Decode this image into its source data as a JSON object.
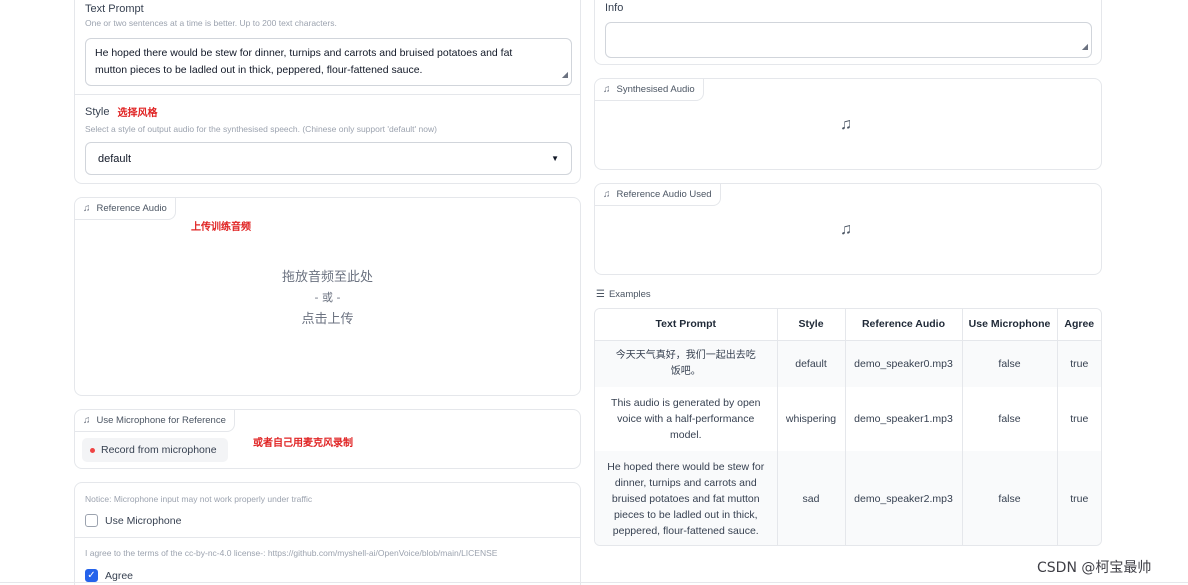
{
  "left": {
    "text_prompt": {
      "title": "Text Prompt",
      "description": "One or two sentences at a time is better. Up to 200 text characters.",
      "value_line1": "He hoped there would be stew for dinner, turnips and carrots and bruised potatoes and fat",
      "value_line2": "mutton pieces to be ladled out in thick, peppered, flour-fattened sauce."
    },
    "style": {
      "title": "Style",
      "annotation": "选择风格",
      "description": "Select a style of output audio for the synthesised speech. (Chinese only support 'default' now)",
      "selected": "default"
    },
    "reference_audio": {
      "label": "Reference Audio",
      "annotation": "上传训练音频",
      "drop_text": "拖放音频至此处",
      "or_text": "- 或 -",
      "click_text": "点击上传"
    },
    "microphone_ref": {
      "label": "Use Microphone for Reference",
      "annotation": "或者自己用麦克风录制",
      "record_button": "Record from microphone"
    },
    "mic_notice": {
      "notice": "Notice: Microphone input may not work properly under traffic",
      "checkbox_label": "Use Microphone",
      "checked": false
    },
    "agree": {
      "terms": "I agree to the terms of the cc-by-nc-4.0 license-: https://github.com/myshell-ai/OpenVoice/blob/main/LICENSE",
      "checkbox_label": "Agree",
      "checked": true
    }
  },
  "right": {
    "info": {
      "title": "Info",
      "value": ""
    },
    "synth_audio": {
      "label": "Synthesised Audio"
    },
    "ref_audio_used": {
      "label": "Reference Audio Used"
    },
    "examples": {
      "label": "Examples",
      "headers": [
        "Text Prompt",
        "Style",
        "Reference Audio",
        "Use Microphone",
        "Agree"
      ],
      "rows": [
        {
          "prompt_lines": [
            "今天天气真好，我们一起出去吃",
            "饭吧。"
          ],
          "style": "default",
          "audio": "demo_speaker0.mp3",
          "mic": "false",
          "agree": "true"
        },
        {
          "prompt_lines": [
            "This audio is generated by open",
            "voice with a half-performance",
            "model."
          ],
          "style": "whispering",
          "audio": "demo_speaker1.mp3",
          "mic": "false",
          "agree": "true"
        },
        {
          "prompt_lines": [
            "He hoped there would be stew for",
            "dinner, turnips and carrots and",
            "bruised potatoes and fat mutton",
            "pieces to be ladled out in thick,",
            "peppered, flour-fattened sauce."
          ],
          "style": "sad",
          "audio": "demo_speaker2.mp3",
          "mic": "false",
          "agree": "true"
        }
      ]
    }
  },
  "watermark": "CSDN @柯宝最帅",
  "icons": {
    "music": "music-note-icon",
    "list": "list-icon",
    "caret": "caret-down-icon",
    "record_dot": "record-dot-icon",
    "check": "check-icon"
  },
  "colors": {
    "accent_blue": "#2563eb",
    "annotation_red": "#e02424",
    "record_red": "#ef4444"
  }
}
